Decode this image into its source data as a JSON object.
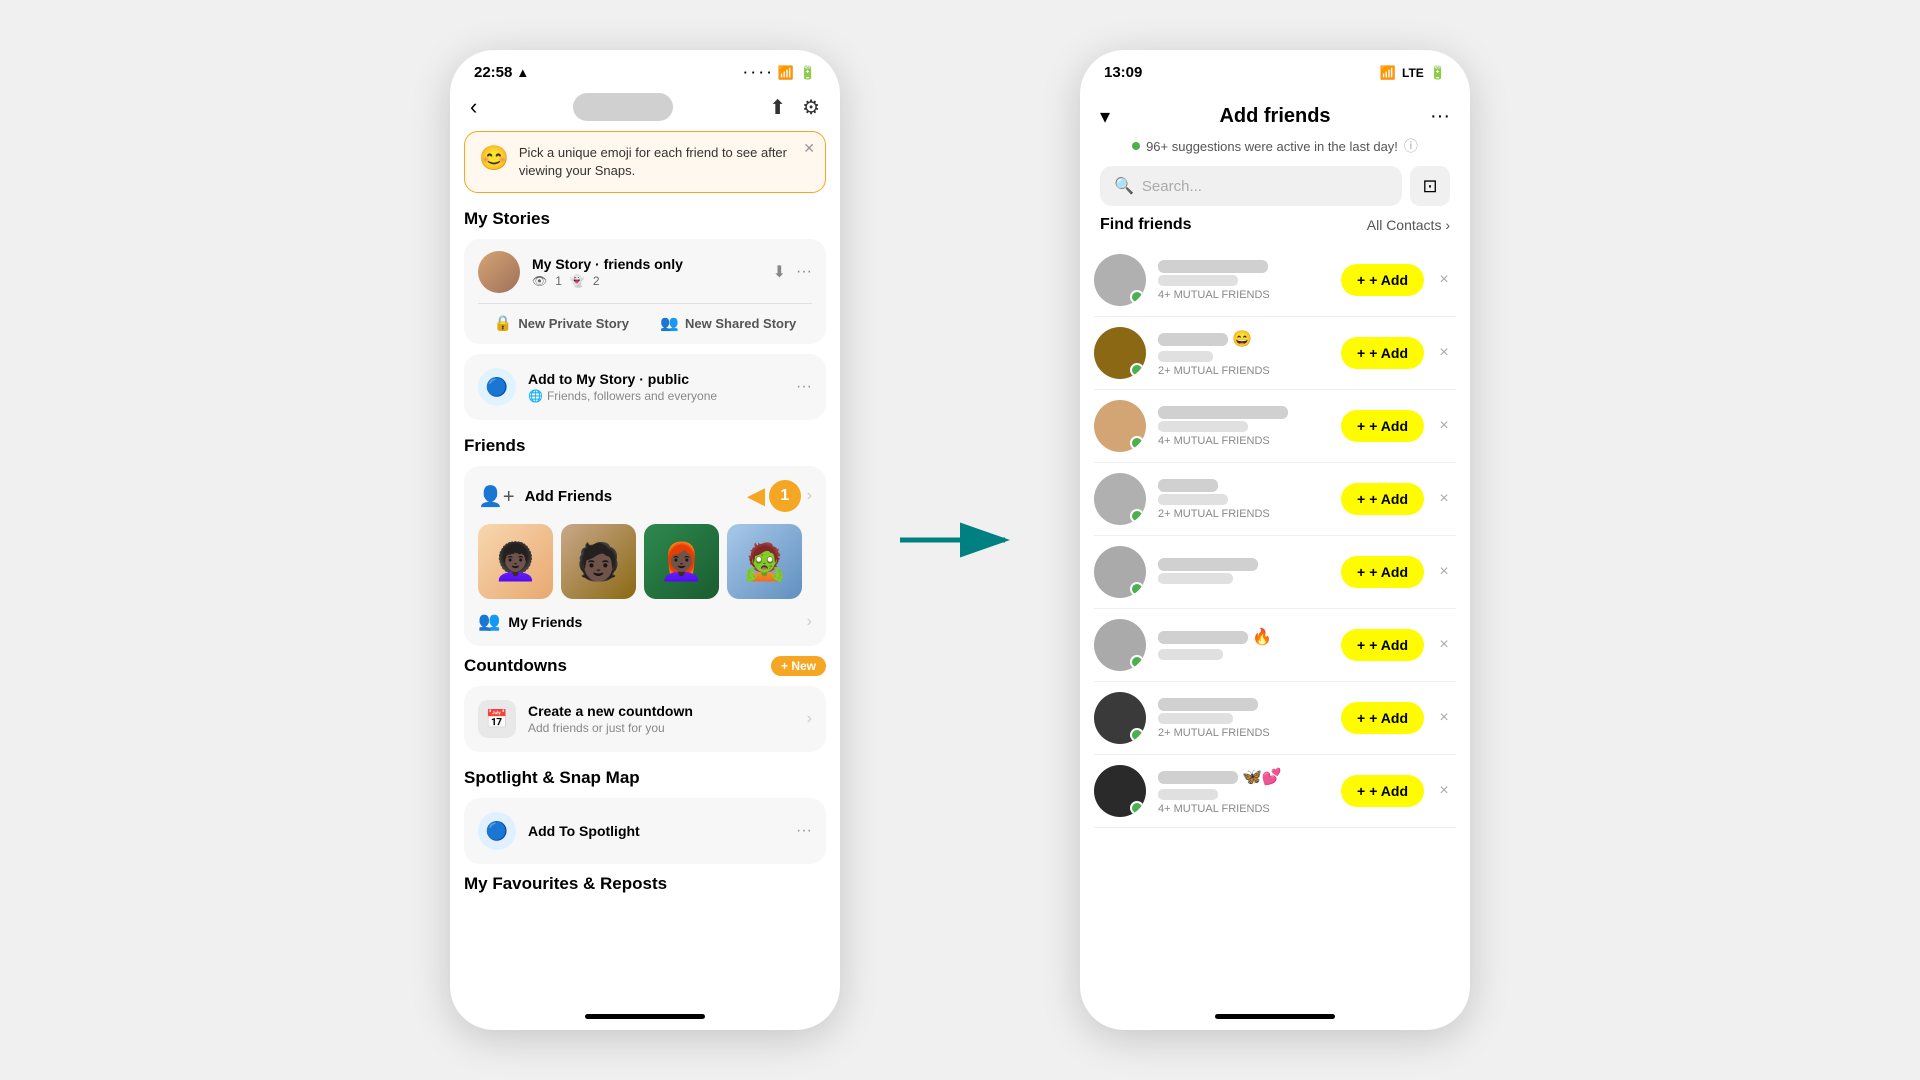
{
  "left_phone": {
    "status_bar": {
      "time": "22:58",
      "arrow": "▲"
    },
    "header": {
      "back": "‹",
      "upload_icon": "⬆",
      "settings_icon": "⚙"
    },
    "promo": {
      "text": "Pick a unique emoji for each friend to see after viewing your Snaps."
    },
    "my_stories": {
      "heading": "My Stories",
      "story": {
        "title": "My Story · friends only",
        "views": "1",
        "snaps": "2"
      },
      "buttons": {
        "private": "New Private Story",
        "shared": "New Shared Story"
      },
      "public": {
        "title": "Add to My Story · public",
        "subtitle": "Friends, followers and everyone"
      }
    },
    "friends": {
      "heading": "Friends",
      "add_friends": "Add Friends",
      "badge": "1",
      "my_friends": "My Friends",
      "avatars": [
        "👩🏿‍🦱",
        "🧑🏿",
        "👩🏿‍🦰",
        "🧟"
      ]
    },
    "countdowns": {
      "heading": "Countdowns",
      "new_label": "+ New",
      "item": {
        "title": "Create a new countdown",
        "subtitle": "Add friends or just for you"
      }
    },
    "spotlight": {
      "heading": "Spotlight & Snap Map",
      "item": {
        "title": "Add To Spotlight"
      }
    },
    "favourites": {
      "heading": "My Favourites & Reposts"
    }
  },
  "right_phone": {
    "status_bar": {
      "time": "13:09"
    },
    "header": {
      "title": "Add friends",
      "subtitle": "96+ suggestions were active in the last day!",
      "info_icon": "ⓘ",
      "chevron": "▾",
      "more": "···"
    },
    "search": {
      "placeholder": "Search...",
      "qr_icon": "⊡"
    },
    "find_friends": {
      "label": "Find friends",
      "contacts": "All Contacts ›"
    },
    "suggestions": [
      {
        "mutual": "4+ MUTUAL FRIENDS",
        "name_width": 110,
        "username_width": 80,
        "avatar_class": "av-gray",
        "online": true,
        "emoji": ""
      },
      {
        "mutual": "2+ MUTUAL FRIENDS",
        "name_width": 70,
        "username_width": 55,
        "avatar_class": "av-brown",
        "online": true,
        "emoji": "😄"
      },
      {
        "mutual": "4+ MUTUAL FRIENDS",
        "name_width": 130,
        "username_width": 90,
        "avatar_class": "av-light",
        "online": true,
        "emoji": ""
      },
      {
        "mutual": "2+ MUTUAL FRIENDS",
        "name_width": 60,
        "username_width": 70,
        "avatar_class": "av-gray",
        "online": true,
        "emoji": ""
      },
      {
        "mutual": "",
        "name_width": 100,
        "username_width": 75,
        "avatar_class": "av-medium",
        "online": true,
        "emoji": ""
      },
      {
        "mutual": "",
        "name_width": 90,
        "username_width": 65,
        "avatar_class": "av-medium",
        "online": true,
        "emoji": "🔥"
      },
      {
        "mutual": "2+ MUTUAL FRIENDS",
        "name_width": 100,
        "username_width": 75,
        "avatar_class": "av-dark",
        "online": true,
        "emoji": ""
      },
      {
        "mutual": "4+ MUTUAL FRIENDS",
        "name_width": 80,
        "username_width": 60,
        "avatar_class": "av-dark",
        "online": true,
        "emoji": "🦋💕"
      }
    ],
    "add_button_label": "+ Add",
    "dismiss_label": "×"
  },
  "arrow": {
    "color": "#008080"
  }
}
